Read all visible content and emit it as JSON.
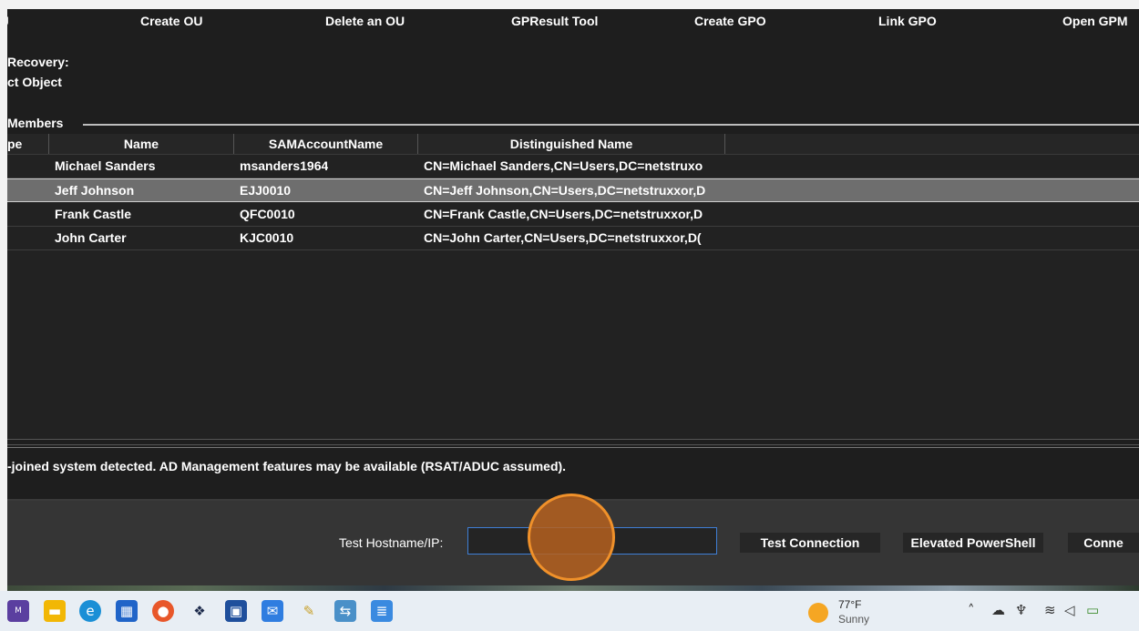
{
  "toolbar": {
    "items": [
      "Create OU",
      "Delete an OU",
      "GPResult Tool",
      "Create GPO",
      "Link GPO",
      "Open GPM"
    ]
  },
  "info": {
    "recovery_label": "Recovery:",
    "object_label": "ct Object"
  },
  "members": {
    "title": "Members",
    "columns": [
      "pe",
      "Name",
      "SAMAccountName",
      "Distinguished Name"
    ],
    "rows": [
      {
        "name": "Michael Sanders",
        "sam": "msanders1964",
        "dn": "CN=Michael Sanders,CN=Users,DC=netstruxo"
      },
      {
        "name": "Jeff Johnson",
        "sam": "EJJ0010",
        "dn": "CN=Jeff Johnson,CN=Users,DC=netstruxxor,D"
      },
      {
        "name": "Frank Castle",
        "sam": "QFC0010",
        "dn": "CN=Frank Castle,CN=Users,DC=netstruxxor,D"
      },
      {
        "name": "John Carter",
        "sam": "KJC0010",
        "dn": "CN=John Carter,CN=Users,DC=netstruxxor,D("
      }
    ],
    "selected_index": 1
  },
  "status": {
    "text": "-joined system detected. AD Management features may be available (RSAT/ADUC assumed)."
  },
  "connection": {
    "hostname_label": "Test Hostname/IP:",
    "hostname_value": "",
    "test_button": "Test Connection",
    "powershell_button": "Elevated PowerShell",
    "connect_button": "Conne"
  },
  "taskbar": {
    "icons": [
      "m365-icon",
      "file-explorer-icon",
      "edge-icon",
      "store-icon",
      "firefox-icon",
      "dropbox-icon",
      "app-icon",
      "outlook-icon",
      "notes-icon",
      "remote-desktop-icon",
      "notepad-icon"
    ],
    "weather": {
      "temp": "77°F",
      "condition": "Sunny"
    },
    "tray": [
      "chevron-up-icon",
      "onedrive-icon",
      "microphone-icon",
      "wifi-icon",
      "volume-icon",
      "battery-icon"
    ]
  },
  "colors": {
    "app_bg": "#1e1e1e",
    "selected_row": "#6e6e6e",
    "input_border": "#3f7fd6",
    "click_indicator": "#f0912a"
  }
}
